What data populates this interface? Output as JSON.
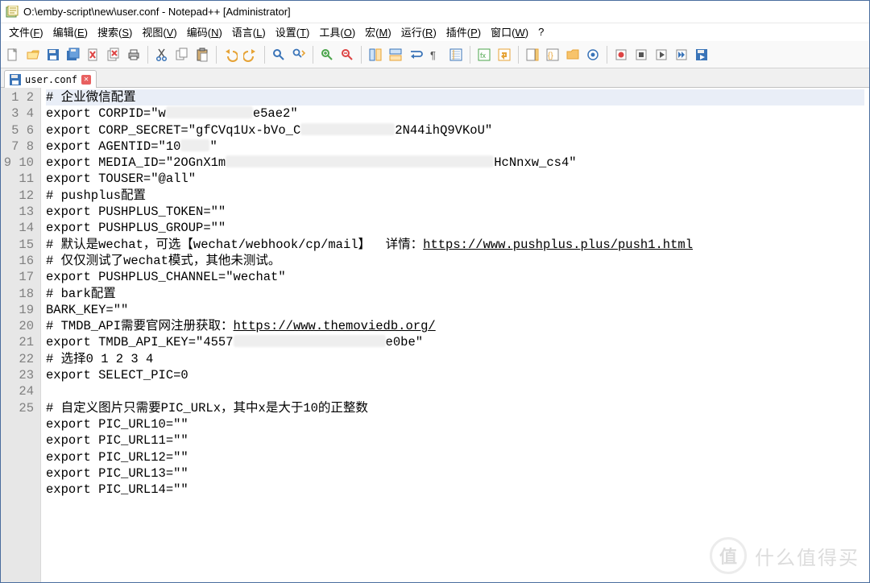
{
  "window": {
    "title": "O:\\emby-script\\new\\user.conf - Notepad++ [Administrator]"
  },
  "menu": {
    "items": [
      {
        "label": "文件(F)",
        "key": "F"
      },
      {
        "label": "编辑(E)",
        "key": "E"
      },
      {
        "label": "搜索(S)",
        "key": "S"
      },
      {
        "label": "视图(V)",
        "key": "V"
      },
      {
        "label": "编码(N)",
        "key": "N"
      },
      {
        "label": "语言(L)",
        "key": "L"
      },
      {
        "label": "设置(T)",
        "key": "T"
      },
      {
        "label": "工具(O)",
        "key": "O"
      },
      {
        "label": "宏(M)",
        "key": "M"
      },
      {
        "label": "运行(R)",
        "key": "R"
      },
      {
        "label": "插件(P)",
        "key": "P"
      },
      {
        "label": "窗口(W)",
        "key": "W"
      },
      {
        "label": "?",
        "key": ""
      }
    ]
  },
  "toolbar": {
    "buttons": [
      "new-file",
      "open-file",
      "save-file",
      "save-all",
      "close-file",
      "close-all",
      "print",
      "sep",
      "cut",
      "copy",
      "paste",
      "sep",
      "undo",
      "redo",
      "sep",
      "find",
      "replace",
      "sep",
      "zoom-in",
      "zoom-out",
      "sep",
      "sync-v",
      "sync-h",
      "wrap",
      "all-chars",
      "indent-guide",
      "sep",
      "lang",
      "eol",
      "sep",
      "doc-map",
      "func-list",
      "folder",
      "monitor",
      "sep",
      "record",
      "stop",
      "play",
      "play-multi",
      "save-macro"
    ]
  },
  "tabs": {
    "active": {
      "label": "user.conf"
    }
  },
  "editor": {
    "lines": [
      "# 企业微信配置",
      "export CORPID=\"w▓▓▓▓▓▓▓▓▓▓▓▓e5ae2\"",
      "export CORP_SECRET=\"gfCVq1Ux-bVo_C▓▓▓▓▓▓▓▓▓▓▓▓▓2N44ihQ9VKoU\"",
      "export AGENTID=\"10▓▓▓▓\"",
      "export MEDIA_ID=\"2OGnX1m▓▓▓▓▓▓▓▓▓▓▓▓▓▓▓▓▓▓▓▓▓▓▓▓▓▓▓▓▓▓▓▓▓▓▓▓▓HcNnxw_cs4\"",
      "export TOUSER=\"@all\"",
      "# pushplus配置",
      "export PUSHPLUS_TOKEN=\"\"",
      "export PUSHPLUS_GROUP=\"\"",
      "# 默认是wechat，可选【wechat/webhook/cp/mail】  详情：https://www.pushplus.plus/push1.html",
      "# 仅仅测试了wechat模式，其他未测试。",
      "export PUSHPLUS_CHANNEL=\"wechat\"",
      "# bark配置",
      "BARK_KEY=\"\"",
      "# TMDB_API需要官网注册获取：https://www.themoviedb.org/",
      "export TMDB_API_KEY=\"4557▓▓▓▓▓▓▓▓▓▓▓▓▓▓▓▓▓▓▓▓▓e0be\"",
      "# 选择0 1 2 3 4",
      "export SELECT_PIC=0",
      "",
      "# 自定义图片只需要PIC_URLx，其中x是大于10的正整数",
      "export PIC_URL10=\"\"",
      "export PIC_URL11=\"\"",
      "export PIC_URL12=\"\"",
      "export PIC_URL13=\"\"",
      "export PIC_URL14=\"\""
    ],
    "links": {
      "10": {
        "text": "https://www.pushplus.plus/push1.html"
      },
      "15": {
        "text": "https://www.themoviedb.org/"
      }
    }
  },
  "watermark": {
    "badge": "值",
    "text": "什么值得买"
  }
}
